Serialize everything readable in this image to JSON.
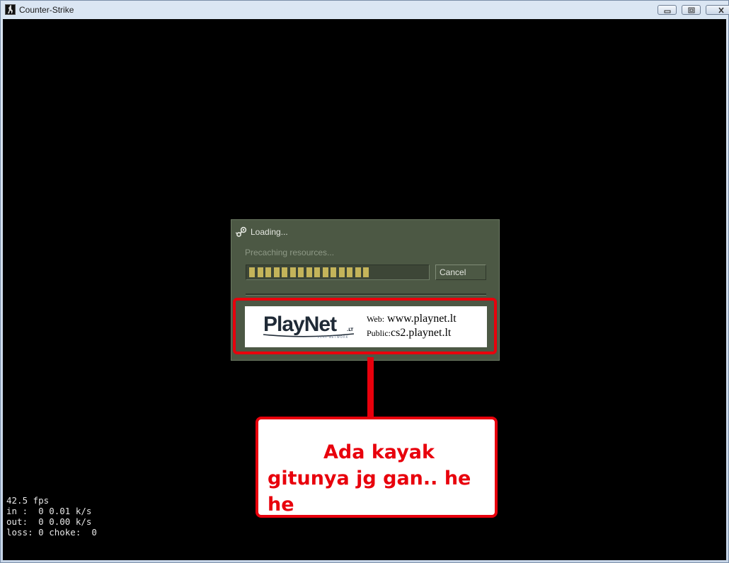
{
  "window": {
    "title": "Counter-Strike",
    "app_icon": "counter-strike-icon",
    "controls": [
      "minimize-icon",
      "maximize-icon",
      "close-icon"
    ]
  },
  "loading_dialog": {
    "title": "Loading...",
    "title_icon": "steam-icon",
    "status": "Precaching resources...",
    "progress": 0.69,
    "cancel_label": "Cancel"
  },
  "banner": {
    "logo_text_play": "Play",
    "logo_text_net": "Net",
    "logo_suffix": ".LT",
    "logo_subtitle": "PLAY NETWORK",
    "web_label": "Web:",
    "web_value": "www.playnet.lt",
    "public_label": "Public:",
    "public_value": "cs2.playnet.lt"
  },
  "annotation": {
    "line1": "Ada kayak",
    "line2": "gitunya jg gan.. he he",
    "color": "#e8000c"
  },
  "net_graph": {
    "fps": "42.5 fps",
    "in": "in :  0 0.01 k/s",
    "out": "out:  0 0.00 k/s",
    "loss": "loss: 0 choke:  0"
  },
  "colors": {
    "dialog_bg": "#4c5844",
    "progress_fill": "#c4b45a",
    "client_bg": "#000000"
  }
}
